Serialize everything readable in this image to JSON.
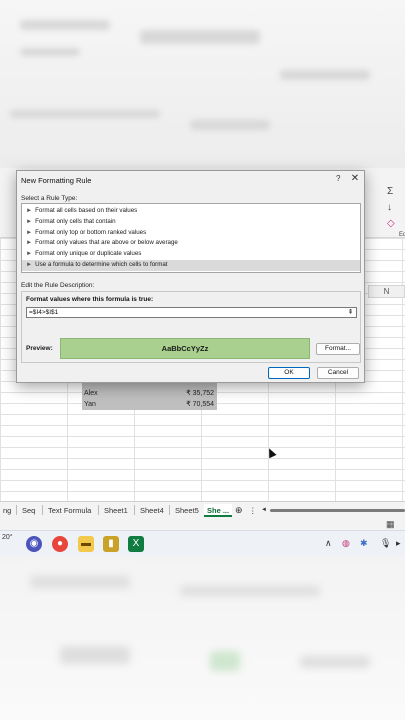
{
  "dialog": {
    "title": "New Formatting Rule",
    "help": "?",
    "close": "✕",
    "select_rule_type_label": "Select a Rule Type:",
    "rule_types": [
      "Format all cells based on their values",
      "Format only cells that contain",
      "Format only top or bottom ranked values",
      "Format only values that are above or below average",
      "Format only unique or duplicate values",
      "Use a formula to determine which cells to format"
    ],
    "selected_rule_index": 5,
    "arrow_glyph": "►",
    "edit_description_label": "Edit the Rule Description:",
    "formula_label": "Format values where this formula is true:",
    "formula_value": "=$I4>$I$1",
    "collapse_glyph": "⇞",
    "preview_label": "Preview:",
    "preview_sample": "AaBbCcYyZz",
    "preview_fill": "#a9d08e",
    "format_button": "Format...",
    "ok_button": "OK",
    "cancel_button": "Cancel"
  },
  "sheet": {
    "column_header": "N",
    "rows": [
      {
        "name": "Alex",
        "amount": "₹ 35,752"
      },
      {
        "name": "Yan",
        "amount": "₹ 70,554"
      }
    ]
  },
  "tabs": {
    "items": [
      "ng",
      "Seq",
      "Text Formula",
      "Sheet1",
      "Sheet4",
      "Sheet5",
      "She ..."
    ],
    "active_index": 6,
    "add_glyph": "⊕",
    "more_glyph": "⋮",
    "prev_glyph": "◄"
  },
  "ribbon": {
    "sum_glyph": "Σ",
    "fill_glyph": "↓",
    "clear_glyph": "◇",
    "edit_label": "Ed"
  },
  "taskbar": {
    "weather": "20°",
    "caret": "∧"
  },
  "colors": {
    "excel_green": "#107c41",
    "preview_green": "#a9d08e",
    "selection_gray": "#dadada"
  }
}
